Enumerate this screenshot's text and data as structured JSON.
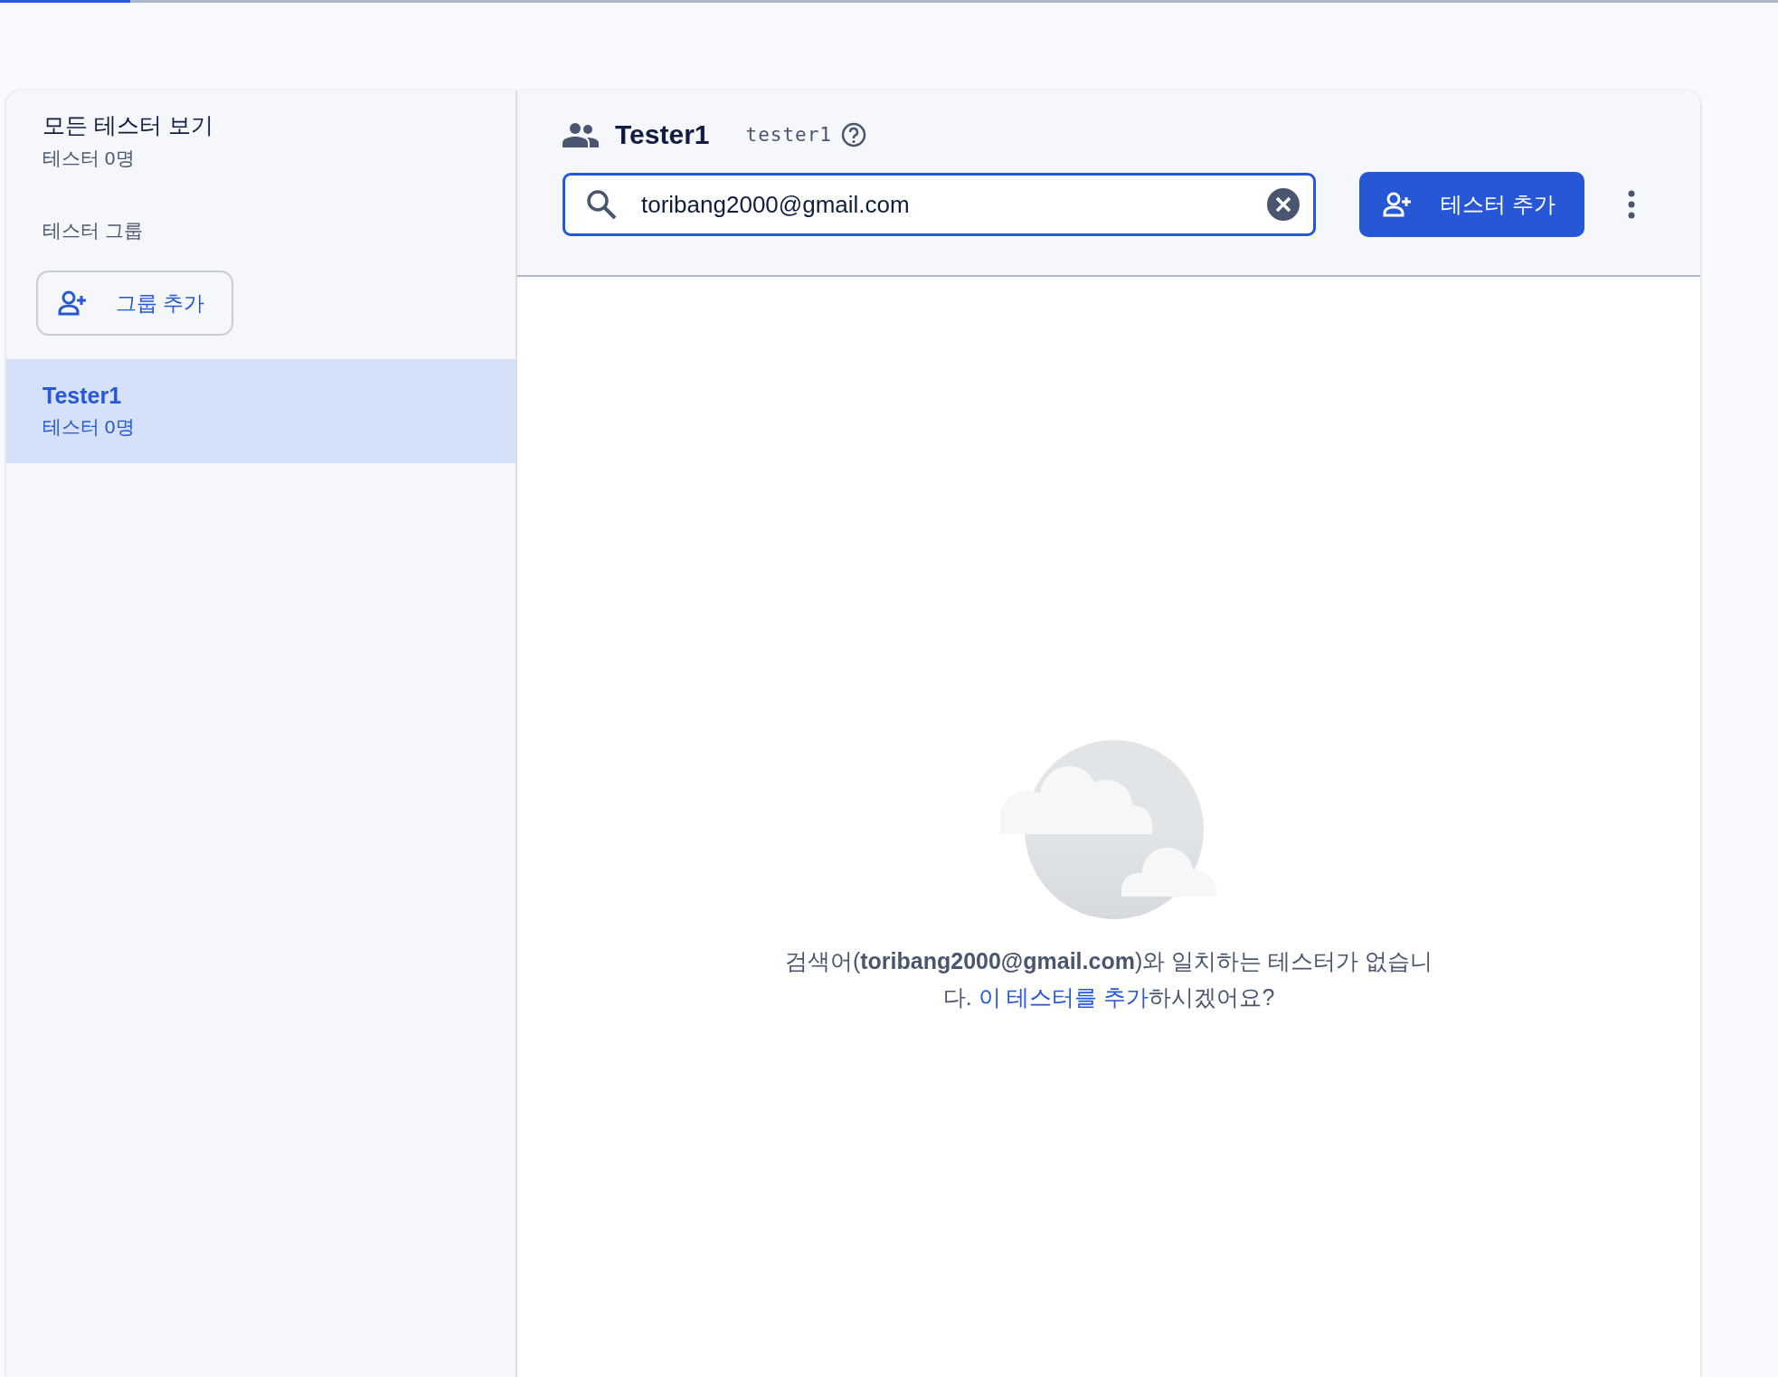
{
  "progress": {
    "level": 0.073
  },
  "sidebar": {
    "all_testers": {
      "title": "모든 테스터 보기",
      "count": "테스터 0명"
    },
    "groups_heading": "테스터 그룹",
    "add_group_button": "그룹 추가",
    "groups": [
      {
        "name": "Tester1",
        "count": "테스터 0명",
        "selected": true
      }
    ]
  },
  "header": {
    "title": "Tester1",
    "alias": "tester1"
  },
  "search": {
    "value": "toribang2000@gmail.com"
  },
  "add_tester_button": "테스터 추가",
  "empty_state": {
    "message": "검색어(**toribang2000@gmail.com**)와 일치하는 테스터가 없습니다. ",
    "link": "이 테스터를 추가",
    "message_end": "하시겠어요?"
  }
}
